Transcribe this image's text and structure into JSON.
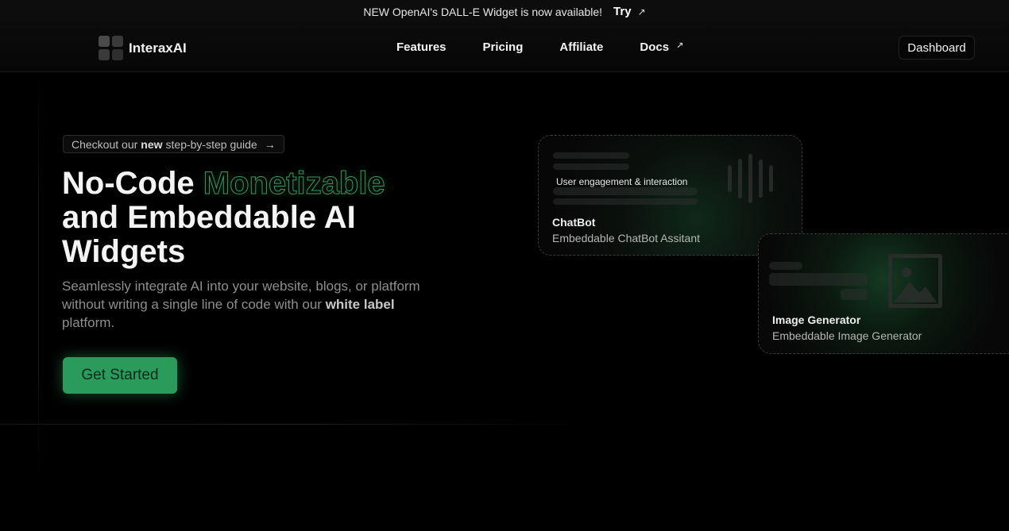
{
  "announcement": {
    "text": "NEW OpenAI's DALL-E Widget is now available!",
    "link_label": "Try",
    "arrow": "↗"
  },
  "nav": {
    "logo_text": "InteraxAI",
    "links": [
      "Features",
      "Pricing",
      "Affiliate",
      "Docs"
    ],
    "docs_arrow": "↗",
    "dashboard_label": "Dashboard"
  },
  "hero": {
    "guide_prefix": "Checkout our",
    "guide_bold": "new",
    "guide_suffix": "step-by-step guide",
    "guide_arrow": "→",
    "title_part1": "No-Code ",
    "title_accent": "Monetizable",
    "title_part2": "and Embeddable AI Widgets",
    "subtitle_start": "Seamlessly integrate AI into your website, blogs, or platform without writing a single line of code with our ",
    "subtitle_bold": "white label",
    "subtitle_end": " platform.",
    "cta_label": "Get Started"
  },
  "cards": {
    "chatbot": {
      "chip": "User engagement & interaction",
      "title": "ChatBot",
      "subtitle": "Embeddable ChatBot Assitant"
    },
    "image_generator": {
      "title": "Image Generator",
      "subtitle": "Embeddable Image Generator"
    }
  },
  "colors": {
    "accent_green": "#2a9b5a",
    "background": "#000000"
  },
  "icons": {
    "logo": "grid-logo-icon",
    "external": "external-arrow-icon",
    "waveform": "waveform-icon",
    "image": "image-icon"
  }
}
